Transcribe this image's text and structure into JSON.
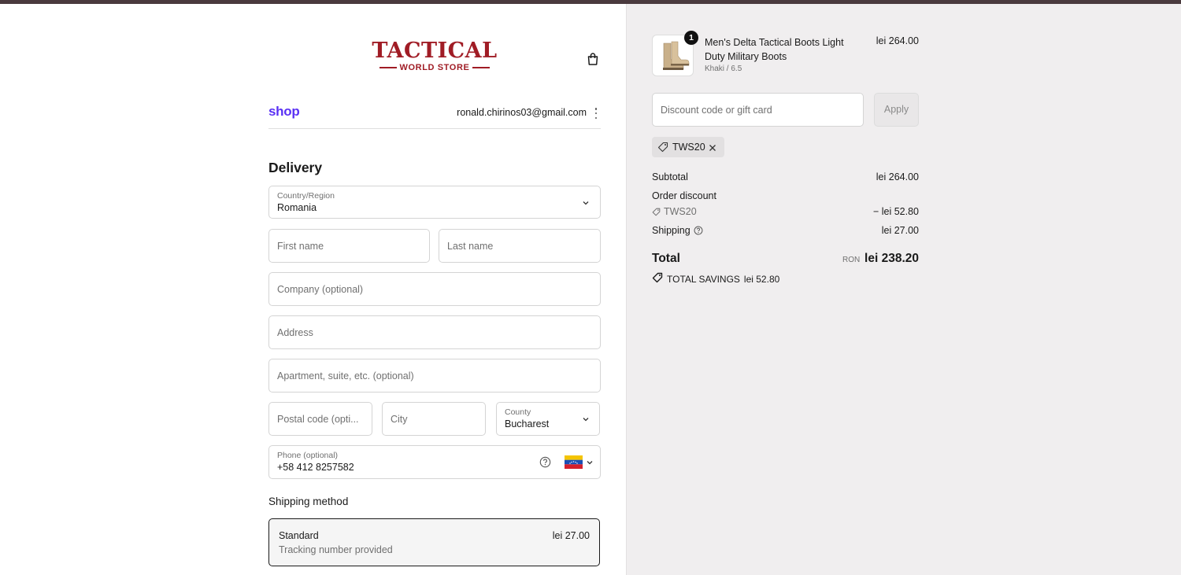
{
  "store": {
    "logo_main": "TACTICAL",
    "logo_sub": "WORLD STORE"
  },
  "account": {
    "shop_label": "shop",
    "email": "ronald.chirinos03@gmail.com"
  },
  "delivery": {
    "title": "Delivery",
    "country_label": "Country/Region",
    "country_value": "Romania",
    "first_name_placeholder": "First name",
    "last_name_placeholder": "Last name",
    "company_placeholder": "Company (optional)",
    "address_placeholder": "Address",
    "apartment_placeholder": "Apartment, suite, etc. (optional)",
    "postal_placeholder": "Postal code (opti...",
    "city_placeholder": "City",
    "county_label": "County",
    "county_value": "Bucharest",
    "phone_label": "Phone (optional)",
    "phone_value": "+58 412 8257582"
  },
  "shipping_method": {
    "title": "Shipping method",
    "option_name": "Standard",
    "option_desc": "Tracking number provided",
    "option_price": "lei 27.00"
  },
  "cart": {
    "quantity": "1",
    "product_name": "Men's Delta Tactical Boots Light Duty Military Boots",
    "variant": "Khaki / 6.5",
    "price": "lei 264.00"
  },
  "discount": {
    "placeholder": "Discount code or gift card",
    "apply_label": "Apply",
    "applied_code": "TWS20"
  },
  "summary": {
    "subtotal_label": "Subtotal",
    "subtotal_value": "lei 264.00",
    "order_discount_label": "Order discount",
    "discount_code": "TWS20",
    "discount_value": "− lei 52.80",
    "shipping_label": "Shipping",
    "shipping_value": "lei 27.00",
    "total_label": "Total",
    "total_currency": "RON",
    "total_value": "lei 238.20",
    "savings_label": "TOTAL SAVINGS",
    "savings_value": "lei 52.80"
  },
  "colors": {
    "brand_red": "#a01c25",
    "shop_purple": "#5a31f4",
    "top_bar": "#4a3a3e",
    "summary_bg": "#f0eeef"
  }
}
